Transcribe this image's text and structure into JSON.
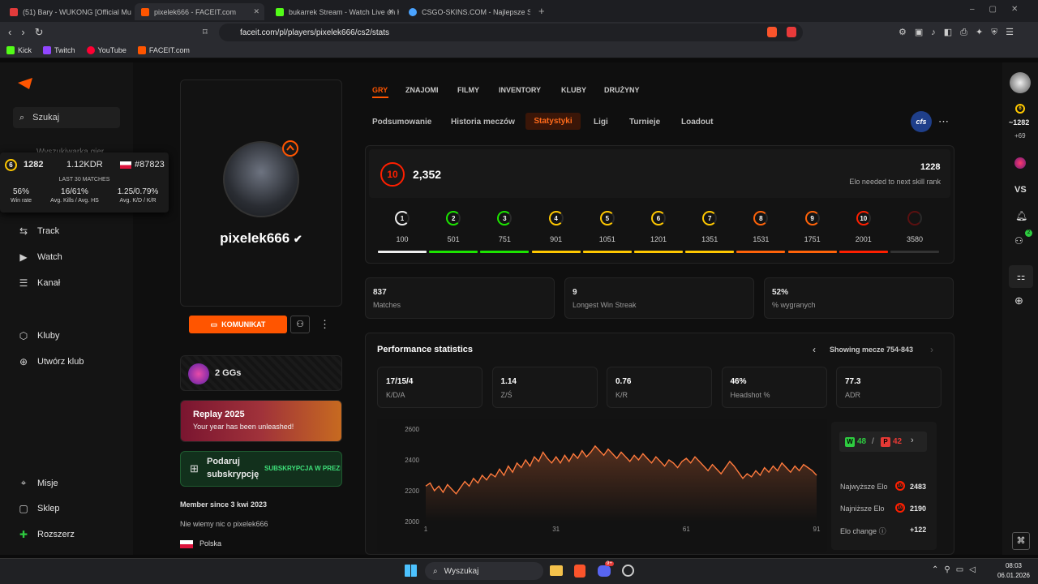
{
  "browser": {
    "tabs": [
      {
        "title": "(51) Bary - WUKONG [Official Mu",
        "color": "#e23b3b"
      },
      {
        "title": "pixelek666 - FACEIT.com",
        "color": "#ff5500"
      },
      {
        "title": "bukarrek Stream - Watch Live on Kick",
        "color": "#53fc18"
      },
      {
        "title": "CSGO-SKINS.COM - Najlepsze Skrzyn",
        "color": "#4aa3ff"
      }
    ],
    "new_tab": "+",
    "url": "faceit.com/pl/players/pixelek666/cs2/stats",
    "bookmarks": [
      {
        "label": "Kick",
        "color": "#53fc18"
      },
      {
        "label": "Twitch",
        "color": "#9146ff"
      },
      {
        "label": "YouTube",
        "color": "#ff0033"
      },
      {
        "label": "FACEIT.com",
        "color": "#ff5500"
      }
    ]
  },
  "leftnav": {
    "search": "Szukaj",
    "hidden_item": "Wyszukiwarka gier",
    "items": [
      "Track",
      "Watch",
      "Kanał",
      "Kluby",
      "Utwórz klub",
      "Misje",
      "Sklep",
      "Rozszerz"
    ]
  },
  "popup": {
    "level": "6",
    "elo": "1282",
    "kdr": "1.12KDR",
    "rank": "#87823",
    "caption": "LAST 30 MATCHES",
    "stats": [
      {
        "value": "56%",
        "label": "Win rate"
      },
      {
        "value": "16/61%",
        "label": "Avg. Kills / Avg. HS"
      },
      {
        "value": "1.25/0.79%",
        "label": "Avg. K/D / K/R"
      }
    ]
  },
  "profile": {
    "name": "pixelek666",
    "message_button": "KOMUNIKAT",
    "ggs": "2 GGs",
    "replay_title": "Replay 2025",
    "replay_sub": "Your year has been unleashed!",
    "gift_title_1": "Podaruj",
    "gift_title_2": "subskrypcję",
    "gift_cta": "SUBSKRYPCJA W PREZENCIE",
    "member_since": "Member since 3 kwi 2023",
    "about": "Nie wiemy nic o pixelek666",
    "country": "Polska"
  },
  "tabs_top": [
    "GRY",
    "ZNAJOMI",
    "FILMY",
    "INVENTORY",
    "KLUBY",
    "DRUŻYNY"
  ],
  "tabs_sub": [
    "Podsumowanie",
    "Historia meczów",
    "Statystyki",
    "Ligi",
    "Turnieje",
    "Loadout"
  ],
  "team_logo": "cfs",
  "elo_panel": {
    "level": "10",
    "elo": "2,352",
    "needed": "1228",
    "needed_label": "Elo needed to next skill rank",
    "levels": [
      {
        "n": "1",
        "v": "100",
        "color": "#eeeeee"
      },
      {
        "n": "2",
        "v": "501",
        "color": "#1ce400"
      },
      {
        "n": "3",
        "v": "751",
        "color": "#1ce400"
      },
      {
        "n": "4",
        "v": "901",
        "color": "#ffc800"
      },
      {
        "n": "5",
        "v": "1051",
        "color": "#ffc800"
      },
      {
        "n": "6",
        "v": "1201",
        "color": "#ffc800"
      },
      {
        "n": "7",
        "v": "1351",
        "color": "#ffc800"
      },
      {
        "n": "8",
        "v": "1531",
        "color": "#ff6309"
      },
      {
        "n": "9",
        "v": "1751",
        "color": "#ff6309"
      },
      {
        "n": "10",
        "v": "2001",
        "color": "#fe1f00"
      },
      {
        "n": "",
        "v": "3580",
        "color": "#5a1010"
      }
    ]
  },
  "summary": [
    {
      "value": "837",
      "label": "Matches"
    },
    {
      "value": "9",
      "label": "Longest Win Streak"
    },
    {
      "value": "52%",
      "label": "% wygranych"
    }
  ],
  "performance": {
    "title": "Performance statistics",
    "range": "Showing mecze 754-843",
    "stats": [
      {
        "value": "17/15/4",
        "label": "K/D/A"
      },
      {
        "value": "1.14",
        "label": "Z/Ś"
      },
      {
        "value": "0.76",
        "label": "K/R"
      },
      {
        "value": "46%",
        "label": "Headshot %"
      },
      {
        "value": "77.3",
        "label": "ADR"
      }
    ]
  },
  "chart_data": {
    "type": "area",
    "x_ticks": [
      "1",
      "31",
      "61",
      "91"
    ],
    "y_ticks": [
      "2600",
      "2400",
      "2200",
      "2000"
    ],
    "ylim": [
      2000,
      2600
    ],
    "xlim": [
      1,
      91
    ],
    "line_color": "#ff7a3d",
    "values": [
      2230,
      2250,
      2200,
      2230,
      2190,
      2240,
      2210,
      2180,
      2220,
      2260,
      2230,
      2280,
      2250,
      2300,
      2270,
      2310,
      2290,
      2340,
      2300,
      2360,
      2320,
      2380,
      2350,
      2400,
      2360,
      2420,
      2390,
      2450,
      2410,
      2380,
      2420,
      2380,
      2430,
      2390,
      2440,
      2410,
      2460,
      2420,
      2450,
      2490,
      2460,
      2430,
      2470,
      2440,
      2410,
      2450,
      2420,
      2390,
      2430,
      2400,
      2440,
      2410,
      2380,
      2420,
      2390,
      2360,
      2400,
      2380,
      2350,
      2390,
      2410,
      2380,
      2420,
      2390,
      2360,
      2330,
      2370,
      2340,
      2310,
      2350,
      2390,
      2360,
      2320,
      2280,
      2310,
      2290,
      2330,
      2300,
      2350,
      2320,
      2360,
      2330,
      2380,
      2350,
      2320,
      2360,
      2330,
      2370,
      2350,
      2330,
      2300
    ]
  },
  "side": {
    "wins": "48",
    "sep": "/",
    "losses": "42",
    "rows": [
      {
        "label": "Najwyższe Elo",
        "value": "2483"
      },
      {
        "label": "Najniższe Elo",
        "value": "2190"
      },
      {
        "label": "Elo change",
        "value": "+122"
      }
    ]
  },
  "rightbar": {
    "elo": "~1282",
    "delta": "+69",
    "vs": "VS",
    "badge": "2"
  },
  "taskbar": {
    "search": "Wyszukaj",
    "time": "08:03",
    "date": "06.01.2026",
    "badge": "9+"
  }
}
